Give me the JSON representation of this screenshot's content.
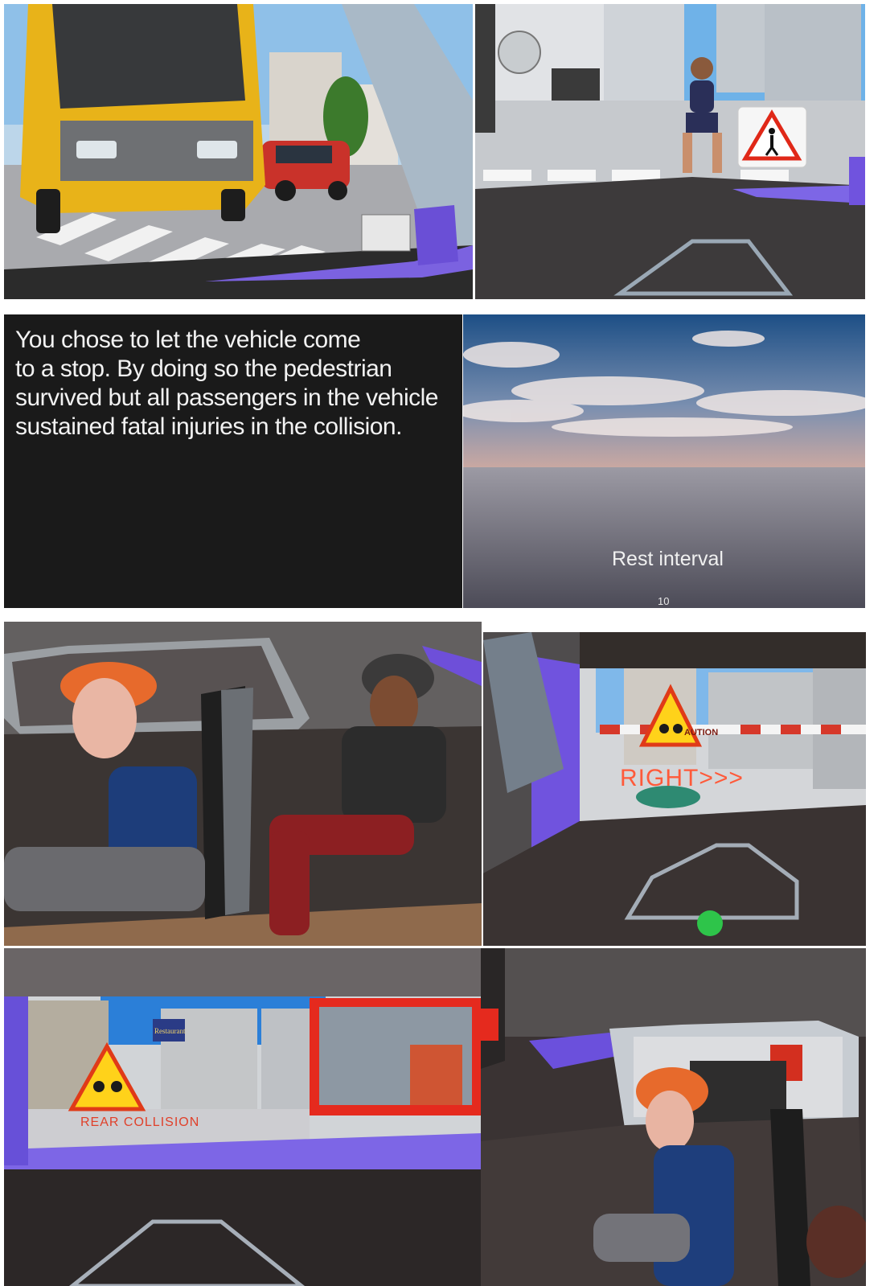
{
  "panels": {
    "crosswalk_bus": {
      "sign_text": ""
    },
    "pedestrian": {
      "sign_icon": "pedestrian-crossing-sign-icon"
    },
    "outcome_message": {
      "lines": [
        "You chose to let the vehicle come",
        "to a stop. By doing so the pedestrian",
        "survived but all passengers in the vehicle",
        "sustained fatal injuries in the collision."
      ]
    },
    "rest": {
      "label": "Rest interval",
      "counter": "10"
    },
    "passengers": {},
    "right_warning": {
      "direction_text": "RIGHT>>>",
      "barrier_text": "AUTION",
      "indicator_color": "#2ec44a"
    },
    "rear_collision": {
      "label": "REAR COLLISION",
      "shop_sign": "Restaurant"
    },
    "passenger_rear": {}
  },
  "colors": {
    "dash_purple": "#6a4fd6",
    "warning_yellow": "#ffd21a",
    "warning_red": "#e02818",
    "sky_blue": "#2b7fd8"
  }
}
